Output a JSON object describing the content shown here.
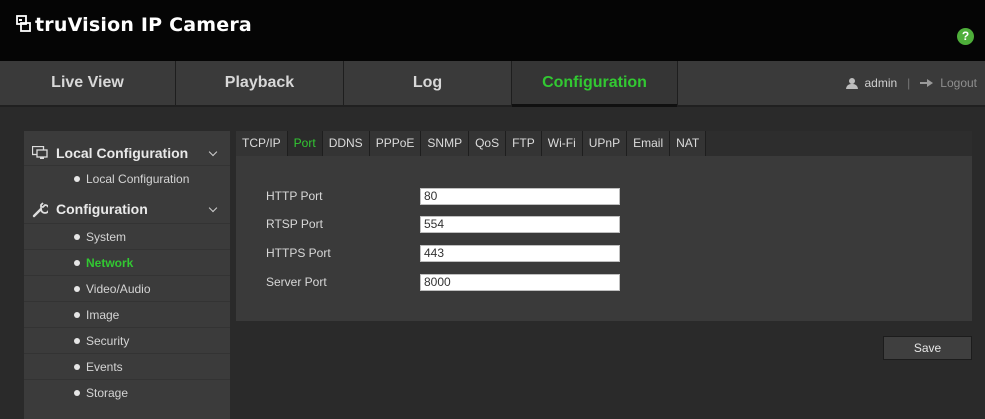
{
  "app": {
    "title": "truVision IP Camera",
    "logo_icon": "truvision-logo-icon"
  },
  "header": {
    "help_label": "?",
    "help_color": "#4eae3a"
  },
  "nav": {
    "tabs": [
      {
        "label": "Live View",
        "active": false
      },
      {
        "label": "Playback",
        "active": false
      },
      {
        "label": "Log",
        "active": false
      },
      {
        "label": "Configuration",
        "active": true
      }
    ],
    "user": "admin",
    "separator": "|",
    "logout_label": "Logout",
    "accent_color": "#32c832"
  },
  "sidebar": {
    "sections": [
      {
        "label": "Local Configuration",
        "icon": "monitor-icon",
        "items": [
          {
            "label": "Local Configuration",
            "active": false
          }
        ]
      },
      {
        "label": "Configuration",
        "icon": "wrench-icon",
        "items": [
          {
            "label": "System",
            "active": false
          },
          {
            "label": "Network",
            "active": true
          },
          {
            "label": "Video/Audio",
            "active": false
          },
          {
            "label": "Image",
            "active": false
          },
          {
            "label": "Security",
            "active": false
          },
          {
            "label": "Events",
            "active": false
          },
          {
            "label": "Storage",
            "active": false
          }
        ]
      }
    ]
  },
  "network": {
    "tabs": [
      {
        "label": "TCP/IP",
        "active": false
      },
      {
        "label": "Port",
        "active": true
      },
      {
        "label": "DDNS",
        "active": false
      },
      {
        "label": "PPPoE",
        "active": false
      },
      {
        "label": "SNMP",
        "active": false
      },
      {
        "label": "QoS",
        "active": false
      },
      {
        "label": "FTP",
        "active": false
      },
      {
        "label": "Wi-Fi",
        "active": false
      },
      {
        "label": "UPnP",
        "active": false
      },
      {
        "label": "Email",
        "active": false
      },
      {
        "label": "NAT",
        "active": false
      }
    ],
    "ports": [
      {
        "label": "HTTP Port",
        "value": "80"
      },
      {
        "label": "RTSP Port",
        "value": "554"
      },
      {
        "label": "HTTPS Port",
        "value": "443"
      },
      {
        "label": "Server Port",
        "value": "8000"
      }
    ],
    "save_label": "Save"
  }
}
